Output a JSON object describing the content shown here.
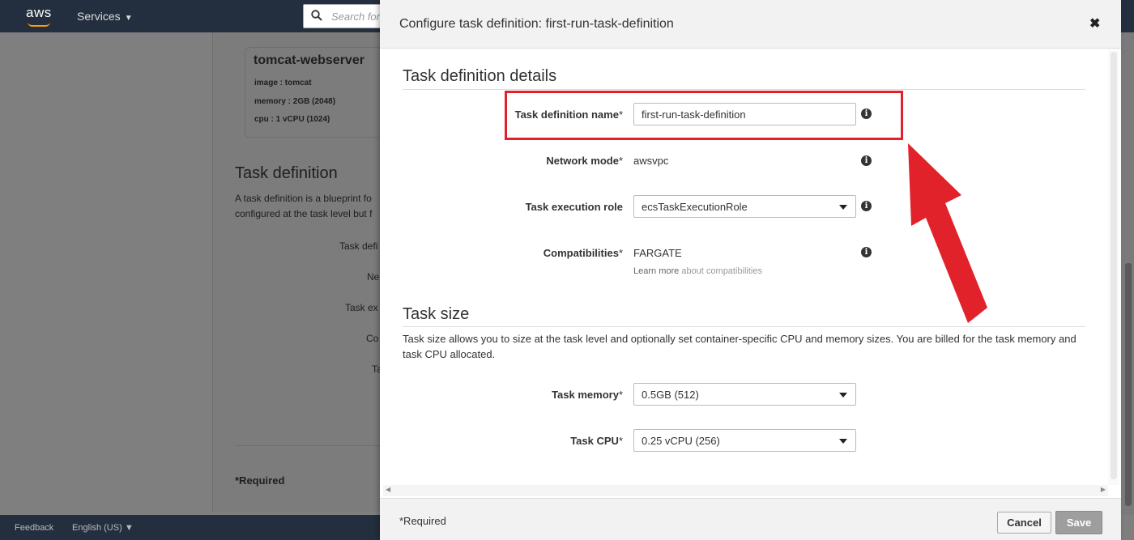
{
  "topbar": {
    "logo_text": "aws",
    "services_label": "Services",
    "search_placeholder": "Search for"
  },
  "background_page": {
    "service_card": {
      "title": "tomcat-webserver",
      "image_line": "image : tomcat",
      "memory_line": "memory :  2GB (2048)",
      "cpu_line": "cpu :  1 vCPU (1024)"
    },
    "section_title": "Task definition",
    "description_line1": "A task definition is a blueprint fo",
    "description_line2": "configured at the task level but f",
    "labels": [
      "Task defi",
      "Ne",
      "Task ex",
      "Co",
      "Ta"
    ],
    "required": "*Required"
  },
  "footer": {
    "feedback": "Feedback",
    "language": "English (US)"
  },
  "modal": {
    "title": "Configure task definition: first-run-task-definition",
    "close_symbol": "✖",
    "details_section": {
      "title": "Task definition details",
      "task_definition_name": {
        "label": "Task definition name",
        "required_mark": "*",
        "value": "first-run-task-definition"
      },
      "network_mode": {
        "label": "Network mode",
        "required_mark": "*",
        "value": "awsvpc"
      },
      "task_execution_role": {
        "label": "Task execution role",
        "value": "ecsTaskExecutionRole"
      },
      "compatibilities": {
        "label": "Compatibilities",
        "required_mark": "*",
        "value": "FARGATE",
        "learn_more": "Learn more",
        "learn_more_link": "about compatibilities"
      }
    },
    "size_section": {
      "title": "Task size",
      "description": "Task size allows you to size at the task level and optionally set container-specific CPU and memory sizes. You are billed for the task memory and task CPU allocated.",
      "task_memory": {
        "label": "Task memory",
        "required_mark": "*",
        "value": "0.5GB (512)"
      },
      "task_cpu": {
        "label": "Task CPU",
        "required_mark": "*",
        "value": "0.25 vCPU (256)"
      }
    },
    "required_note": "*Required",
    "cancel_label": "Cancel",
    "save_label": "Save",
    "info_symbol": "i"
  },
  "colors": {
    "highlight": "#e2222a",
    "navbar": "#232f3e"
  }
}
